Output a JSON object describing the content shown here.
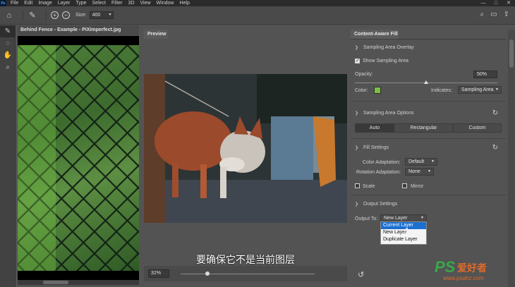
{
  "app": {
    "logo": "Ps",
    "menus": [
      "File",
      "Edit",
      "Image",
      "Layer",
      "Type",
      "Select",
      "Filter",
      "3D",
      "View",
      "Window",
      "Help"
    ],
    "window_controls": [
      "—",
      "□",
      "✕"
    ]
  },
  "options_bar": {
    "size_label": "Size:",
    "size_value": "400"
  },
  "tools": [
    "brush-icon",
    "lasso-icon",
    "hand-icon",
    "zoom-icon"
  ],
  "document": {
    "tab_title": "Behind Fence - Example - PiXimperfect.jpg"
  },
  "preview": {
    "tab_label": "Preview",
    "zoom": "32%",
    "zoom_level": 0.2,
    "subtitle": "要确保它不是当前图层"
  },
  "panel": {
    "title": "Content-Aware Fill",
    "sampling_overlay": {
      "title": "Sampling Area Overlay",
      "show_label": "Show Sampling Area",
      "show_checked": true,
      "opacity_label": "Opacity:",
      "opacity_value": "50%",
      "opacity_level": 0.5,
      "color_label": "Color:",
      "color_hex": "#7ac142",
      "indicates_label": "Indicates:",
      "indicates_value": "Sampling Area"
    },
    "sampling_options": {
      "title": "Sampling Area Options",
      "buttons": [
        "Auto",
        "Rectangular",
        "Custom"
      ],
      "selected": "Auto"
    },
    "fill_settings": {
      "title": "Fill Settings",
      "color_adapt_label": "Color Adaptation:",
      "color_adapt_value": "Default",
      "rotation_adapt_label": "Rotation Adaptation:",
      "rotation_adapt_value": "None",
      "scale_label": "Scale",
      "mirror_label": "Mirror"
    },
    "output_settings": {
      "title": "Output Settings",
      "output_label": "Output To:",
      "output_value": "New Layer",
      "options": [
        "Current Layer",
        "New Layer",
        "Duplicate Layer"
      ],
      "highlighted": "Current Layer"
    }
  },
  "watermark": {
    "brand": "PS",
    "cn": "爱好者",
    "url": "www.psahz.com"
  }
}
